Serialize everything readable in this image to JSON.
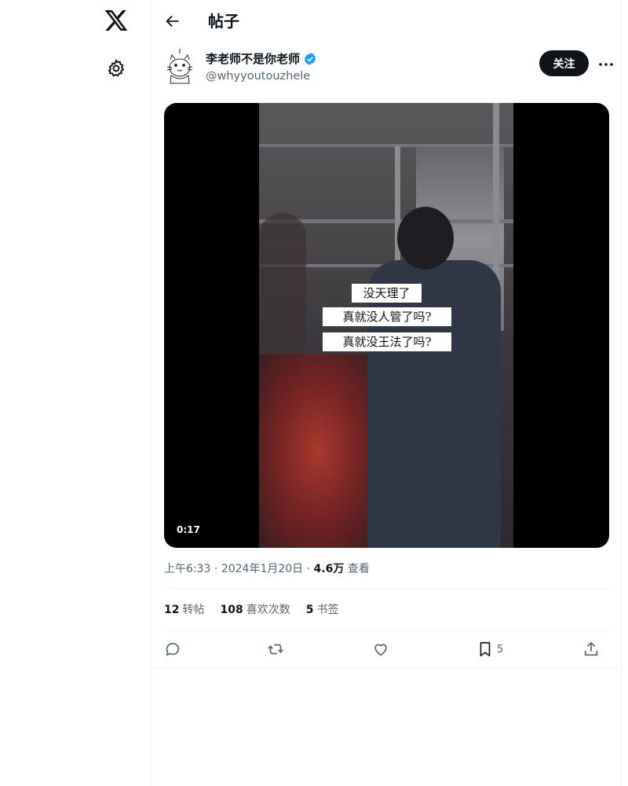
{
  "header": {
    "title": "帖子"
  },
  "author": {
    "name": "李老师不是你老师",
    "handle": "@whyyoutouzhele",
    "follow_label": "关注"
  },
  "video": {
    "duration": "0:17",
    "captions": [
      "没天理了",
      "真就没人管了吗?",
      "真就没王法了吗?"
    ]
  },
  "meta": {
    "time": "上午6:33",
    "separator": "·",
    "date": "2024年1月20日",
    "views_count": "4.6万",
    "views_label": "查看"
  },
  "stats": {
    "retweets_count": "12",
    "retweets_label": "转帖",
    "likes_count": "108",
    "likes_label": "喜欢次数",
    "bookmarks_count": "5",
    "bookmarks_label": "书签"
  },
  "actions": {
    "bookmark_count": "5"
  },
  "colors": {
    "text": "#0f1419",
    "muted": "#536471",
    "verified": "#1d9bf0",
    "border": "#eff3f4"
  }
}
